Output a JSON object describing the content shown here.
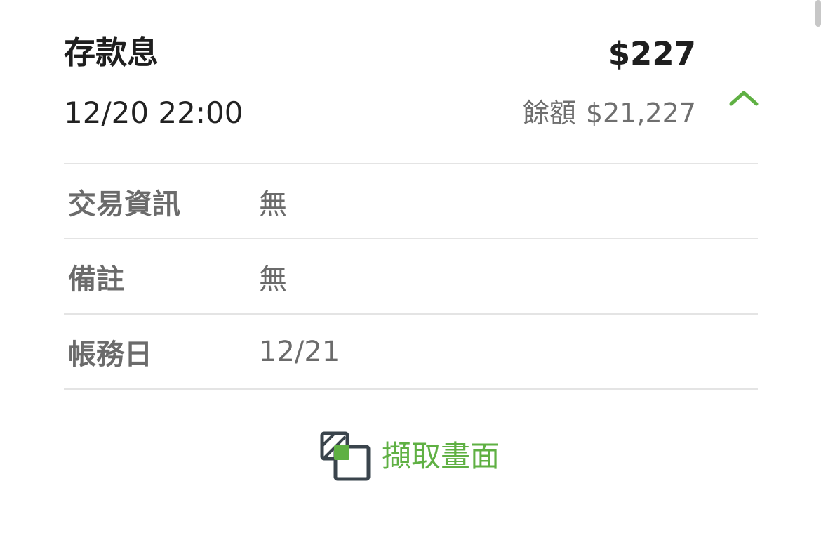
{
  "transaction": {
    "title": "存款息",
    "amount": "$227",
    "datetime": "12/20 22:00",
    "balance_label": "餘額",
    "balance_value": "$21,227"
  },
  "details": [
    {
      "label": "交易資訊",
      "value": "無"
    },
    {
      "label": "備註",
      "value": "無"
    },
    {
      "label": "帳務日",
      "value": "12/21"
    }
  ],
  "actions": {
    "screenshot_label": "擷取畫面",
    "collapse_icon": "chevron-up-icon",
    "screenshot_icon": "screenshot-icon"
  },
  "colors": {
    "accent": "#5fb043",
    "divider": "#e4e4e4",
    "muted_text": "#6b6b6b",
    "primary_text": "#1f1f1f"
  }
}
